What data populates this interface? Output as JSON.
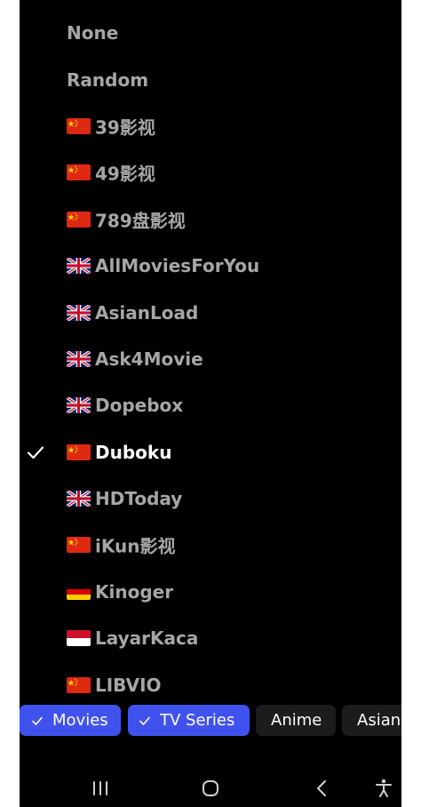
{
  "providers": [
    {
      "label": "None",
      "flag": "",
      "selected": false
    },
    {
      "label": "Random",
      "flag": "",
      "selected": false
    },
    {
      "label": "39影视",
      "flag": "cn-flag",
      "selected": false
    },
    {
      "label": "49影视",
      "flag": "cn-flag",
      "selected": false
    },
    {
      "label": "789盘影视",
      "flag": "cn-flag",
      "selected": false
    },
    {
      "label": "AllMoviesForYou",
      "flag": "uk-flag",
      "selected": false
    },
    {
      "label": "AsianLoad",
      "flag": "uk-flag",
      "selected": false
    },
    {
      "label": "Ask4Movie",
      "flag": "uk-flag",
      "selected": false
    },
    {
      "label": "Dopebox",
      "flag": "uk-flag",
      "selected": false
    },
    {
      "label": "Duboku",
      "flag": "cn-flag",
      "selected": true
    },
    {
      "label": "HDToday",
      "flag": "uk-flag",
      "selected": false
    },
    {
      "label": "iKun影视",
      "flag": "cn-flag",
      "selected": false
    },
    {
      "label": "Kinoger",
      "flag": "de-flag",
      "selected": false
    },
    {
      "label": "LayarKaca",
      "flag": "id-flag",
      "selected": false
    },
    {
      "label": "LIBVIO",
      "flag": "cn-flag",
      "selected": false
    }
  ],
  "filters": [
    {
      "label": "Movies",
      "active": true
    },
    {
      "label": "TV Series",
      "active": true
    },
    {
      "label": "Anime",
      "active": false
    },
    {
      "label": "Asian",
      "active": false
    }
  ],
  "colors": {
    "accent": "#4052ee",
    "chip_inactive": "#1c1c1e",
    "text_muted": "#a6a6a6",
    "text_selected": "#ffffff"
  },
  "navbar": {
    "icons": [
      "recents-icon",
      "home-icon",
      "back-icon",
      "accessibility-icon"
    ]
  }
}
